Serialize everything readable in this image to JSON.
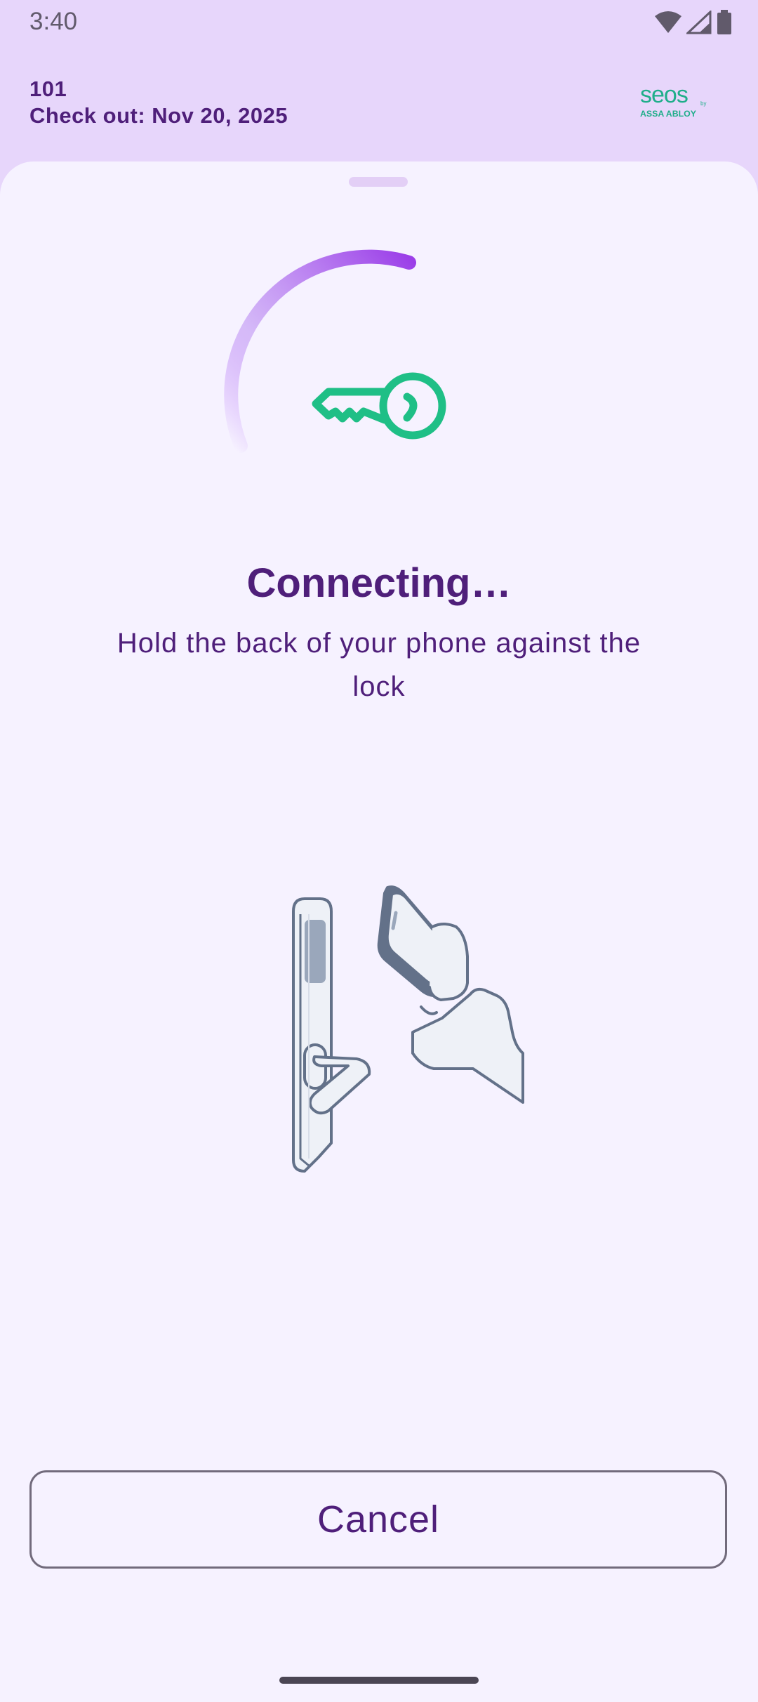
{
  "status_bar": {
    "time": "3:40",
    "icons": [
      "wifi-icon",
      "cellular-signal-icon",
      "battery-icon"
    ]
  },
  "header": {
    "room": "101",
    "checkout": "Check out: Nov 20, 2025",
    "logo": {
      "wordmark": "seos",
      "by": "by",
      "company": "ASSA ABLOY"
    }
  },
  "sheet": {
    "status_icon": "key-icon",
    "title": "Connecting…",
    "subtitle": "Hold the back of your phone against the lock",
    "illustration": "phone-to-lock-illustration",
    "cancel_label": "Cancel"
  },
  "colors": {
    "accent": "#4f1f7a",
    "progress": "#a855f7",
    "key": "#1fbf86",
    "header_bg": "#e7d6fb",
    "sheet_bg": "#f6f2ff"
  }
}
